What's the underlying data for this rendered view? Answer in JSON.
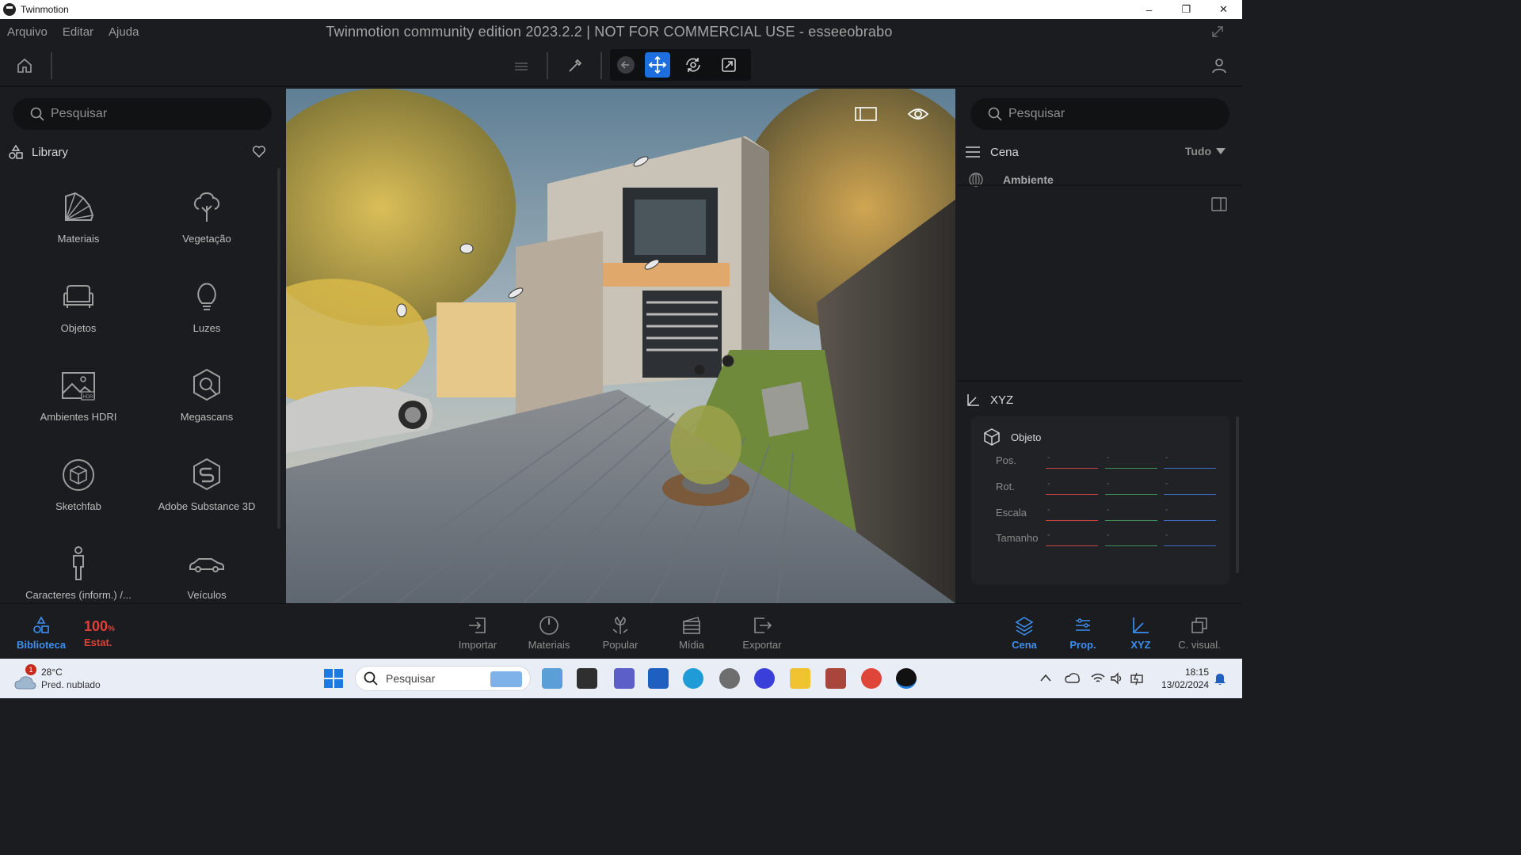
{
  "window": {
    "app_name": "Twinmotion",
    "controls": [
      "–",
      "❐",
      "✕"
    ]
  },
  "menu": {
    "items": [
      "Arquivo",
      "Editar",
      "Ajuda"
    ],
    "document_title": "Twinmotion community edition 2023.2.2 | NOT FOR COMMERCIAL USE - esseeobrabo"
  },
  "toolbar": {
    "icons": [
      "home-icon",
      "layers-icon",
      "eyedropper-icon",
      "back-arrow-icon",
      "move-icon",
      "rotate-icon",
      "scale-icon",
      "user-icon"
    ],
    "active_tool": "move"
  },
  "left_panel": {
    "search_placeholder": "Pesquisar",
    "library_label": "Library",
    "items": [
      {
        "label": "Materiais",
        "icon": "materials-fan-icon"
      },
      {
        "label": "Vegetação",
        "icon": "tree-icon"
      },
      {
        "label": "Objetos",
        "icon": "sofa-icon"
      },
      {
        "label": "Luzes",
        "icon": "bulb-icon"
      },
      {
        "label": "Ambientes HDRI",
        "icon": "hdri-image-icon"
      },
      {
        "label": "Megascans",
        "icon": "megascans-icon"
      },
      {
        "label": "Sketchfab",
        "icon": "sketchfab-icon"
      },
      {
        "label": "Adobe Substance 3D",
        "icon": "substance-icon"
      },
      {
        "label": "Caracteres (inform.) /...",
        "icon": "person-icon"
      },
      {
        "label": "Veículos",
        "icon": "car-icon"
      }
    ]
  },
  "right_panel": {
    "search_placeholder": "Pesquisar",
    "scene_label": "Cena",
    "filter_label": "Tudo",
    "ambiente_label": "Ambiente",
    "xyz_label": "XYZ",
    "object_label": "Objeto",
    "properties": [
      {
        "label": "Pos.",
        "x": "-",
        "y": "-",
        "z": "-"
      },
      {
        "label": "Rot.",
        "x": "-",
        "y": "-",
        "z": "-"
      },
      {
        "label": "Escala",
        "x": "-",
        "y": "-",
        "z": "-"
      },
      {
        "label": "Tamanho",
        "x": "-",
        "y": "-",
        "z": "-"
      }
    ],
    "axis_colors": {
      "x": "#c94545",
      "y": "#3f8f58",
      "z": "#3b6fc6"
    }
  },
  "dock": {
    "left": [
      {
        "label": "Biblioteca",
        "icon": "library-icon"
      }
    ],
    "stats": {
      "percent": "100",
      "percent_unit": "%",
      "label": "Estat."
    },
    "center": [
      {
        "label": "Importar",
        "icon": "import-icon"
      },
      {
        "label": "Materiais",
        "icon": "material-picker-icon"
      },
      {
        "label": "Popular",
        "icon": "populate-icon"
      },
      {
        "label": "Mídia",
        "icon": "media-icon"
      },
      {
        "label": "Exportar",
        "icon": "export-icon"
      }
    ],
    "right": [
      {
        "label": "Cena",
        "icon": "scene-layers-icon"
      },
      {
        "label": "Prop.",
        "icon": "properties-icon"
      },
      {
        "label": "XYZ",
        "icon": "xyz-icon"
      },
      {
        "label": "C. visual.",
        "icon": "visual-config-icon"
      }
    ]
  },
  "taskbar": {
    "weather": {
      "notification_count": "1",
      "temperature": "28°C",
      "condition": "Pred. nublado"
    },
    "search_placeholder": "Pesquisar",
    "time": "18:15",
    "date": "13/02/2024"
  },
  "colors": {
    "accent": "#1d6fe0",
    "dock_active": "#3d8ff0",
    "stat_alert": "#e0403a"
  }
}
